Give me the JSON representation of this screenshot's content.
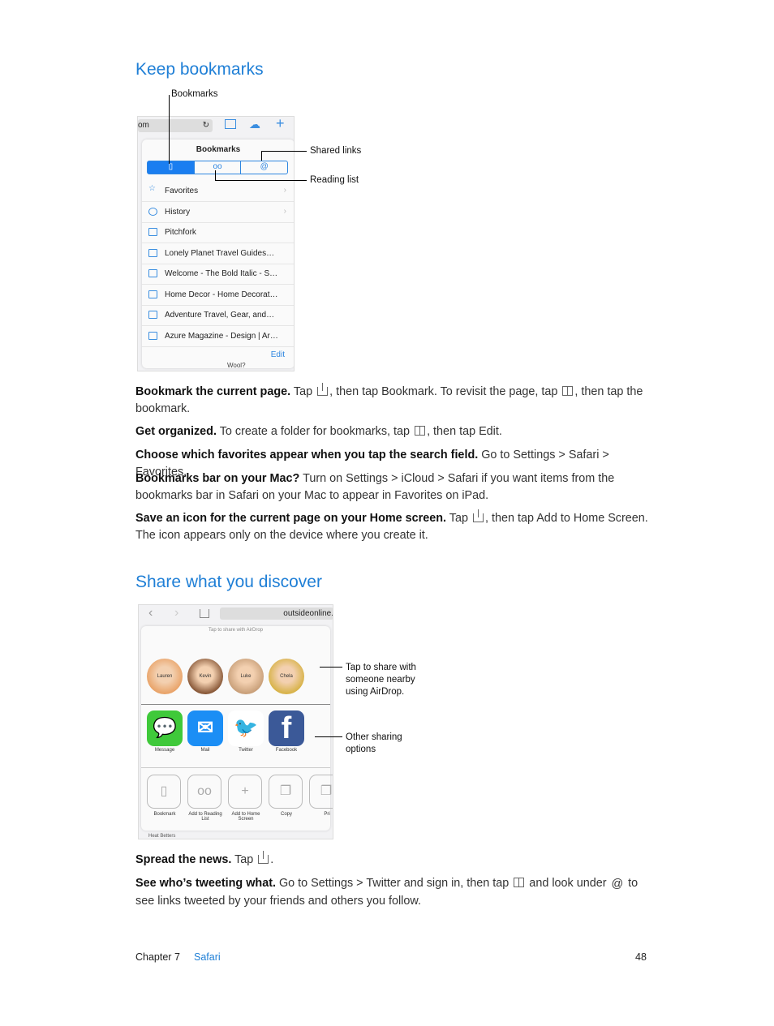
{
  "section1": {
    "heading": "Keep bookmarks",
    "screenshot": {
      "url_fragment": "om",
      "popup_title": "Bookmarks",
      "tabs": [
        "book-icon",
        "glasses-icon",
        "@"
      ],
      "rows": [
        {
          "label": "Favorites",
          "icon": "star-icon",
          "chevron": true
        },
        {
          "label": "History",
          "icon": "clock-icon",
          "chevron": true
        },
        {
          "label": "Pitchfork",
          "icon": "book-icon"
        },
        {
          "label": "Lonely Planet Travel Guides…",
          "icon": "book-icon"
        },
        {
          "label": "Welcome - The Bold Italic - S…",
          "icon": "book-icon"
        },
        {
          "label": "Home Decor - Home Decorat…",
          "icon": "book-icon"
        },
        {
          "label": "Adventure Travel, Gear, and…",
          "icon": "book-icon"
        },
        {
          "label": "Azure Magazine - Design | Ar…",
          "icon": "book-icon"
        }
      ],
      "edit": "Edit",
      "bg_text": "Wool?"
    },
    "callouts": {
      "bookmarks": "Bookmarks",
      "shared": "Shared links",
      "reading": "Reading list"
    }
  },
  "paragraphs": [
    [
      {
        "b": "Bookmark the current page."
      },
      {
        "t": " Tap "
      },
      {
        "i": "share"
      },
      {
        "t": ", then tap Bookmark. To revisit the page, tap "
      },
      {
        "i": "book"
      },
      {
        "t": ", then tap the bookmark."
      }
    ],
    [
      {
        "b": "Get organized."
      },
      {
        "t": " To create a folder for bookmarks, tap "
      },
      {
        "i": "book"
      },
      {
        "t": ", then tap Edit."
      }
    ],
    [
      {
        "b": "Choose which favorites appear when you tap the search field."
      },
      {
        "t": " Go to Settings > Safari > Favorites."
      }
    ],
    [
      {
        "b": "Bookmarks bar on your Mac?"
      },
      {
        "t": " Turn on Settings > iCloud > Safari if you want items from the bookmarks bar in Safari on your Mac to appear in Favorites on iPad."
      }
    ],
    [
      {
        "b": "Save an icon for the current page on your Home screen."
      },
      {
        "t": " Tap "
      },
      {
        "i": "share"
      },
      {
        "t": ", then tap Add to Home Screen. The icon appears only on the device where you create it."
      }
    ],
    [
      {
        "b": "Spread the news."
      },
      {
        "t": " Tap "
      },
      {
        "i": "share"
      },
      {
        "t": "."
      }
    ],
    [
      {
        "b": "See who’s tweeting what."
      },
      {
        "t": " Go to Settings > Twitter and sign in, then tap "
      },
      {
        "i": "book"
      },
      {
        "t": " and look under "
      },
      {
        "i": "at"
      },
      {
        "t": " to see links tweeted by your friends and others you follow."
      }
    ]
  ],
  "section2": {
    "heading": "Share what you discover",
    "screenshot": {
      "url": "outsideonline.",
      "airdrop_title": "Tap to share with AirDrop",
      "people": [
        "Lauren",
        "Kevin",
        "Luke",
        "Chela"
      ],
      "apps": [
        {
          "label": "Message",
          "color": "#3fc93a"
        },
        {
          "label": "Mail",
          "color": "#1b8ef5"
        },
        {
          "label": "Twitter",
          "color": "#ffffff"
        },
        {
          "label": "Facebook",
          "color": "#3b5998"
        }
      ],
      "actions": [
        "Bookmark",
        "Add to Reading List",
        "Add to Home Screen",
        "Copy",
        "Pri"
      ],
      "bg_text": "Heat Betters"
    },
    "callouts": {
      "airdrop": "Tap to share with someone nearby using AirDrop.",
      "other": "Other sharing options"
    }
  },
  "footer": {
    "chapter": "Chapter 7",
    "section": "Safari",
    "page": "48"
  },
  "colors": {
    "accent": "#1f7fd6"
  }
}
